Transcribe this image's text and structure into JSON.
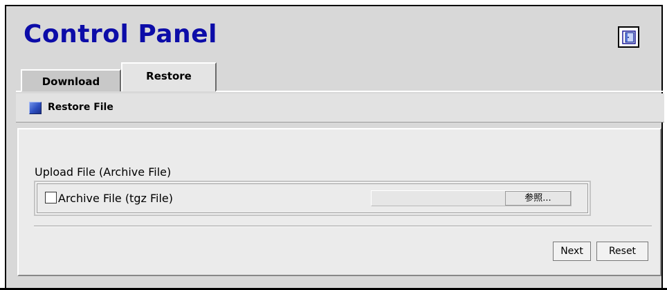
{
  "header": {
    "title": "Control Panel",
    "exit_icon": "exit-door-icon"
  },
  "tabs": [
    {
      "label": "Download",
      "active": false
    },
    {
      "label": "Restore",
      "active": true
    }
  ],
  "section": {
    "icon": "square-bullet-icon",
    "label": "Restore File"
  },
  "form": {
    "heading": "Upload File (Archive File)",
    "archive_checkbox_label": "Archive File (tgz File)",
    "archive_checked": false,
    "file_value": "",
    "browse_label": "参照..."
  },
  "actions": {
    "next_label": "Next",
    "reset_label": "Reset"
  },
  "colors": {
    "title": "#0c0ca8",
    "background": "#d8d8d8",
    "panel": "#ebebeb"
  }
}
